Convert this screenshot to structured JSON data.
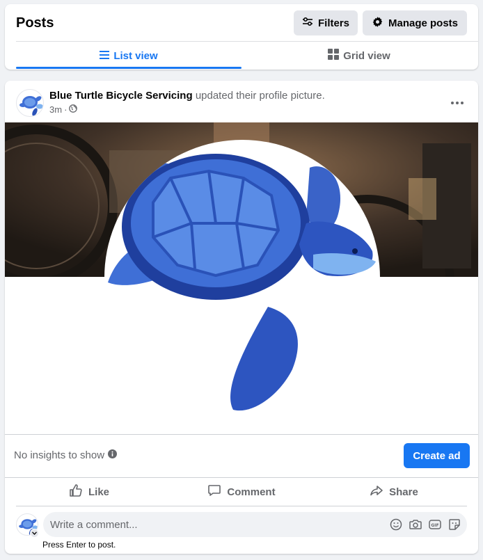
{
  "header": {
    "title": "Posts",
    "filters_label": "Filters",
    "manage_label": "Manage posts",
    "tabs": [
      {
        "label": "List view",
        "active": true
      },
      {
        "label": "Grid view",
        "active": false
      }
    ]
  },
  "post": {
    "page_name": "Blue Turtle Bicycle Servicing",
    "action_text": "updated their profile picture.",
    "time": "3m",
    "separator": "·",
    "privacy_icon": "globe-icon",
    "insights_text": "No insights to show",
    "create_ad_label": "Create ad",
    "actions": {
      "like": "Like",
      "comment": "Comment",
      "share": "Share"
    },
    "comment_placeholder": "Write a comment...",
    "comment_hint": "Press Enter to post."
  },
  "colors": {
    "accent": "#1877f2",
    "turtle_shell": "#3f6fd6",
    "turtle_dark": "#1f3f9e",
    "turtle_light": "#7fb3f0"
  }
}
